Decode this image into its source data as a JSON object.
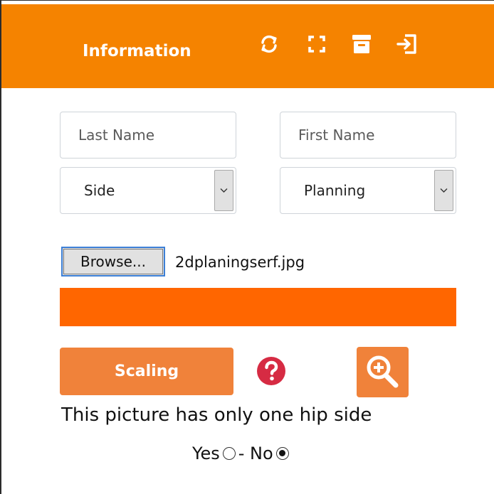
{
  "header": {
    "title": "Information",
    "background": "#f58300",
    "icons": [
      "refresh-icon",
      "fullscreen-icon",
      "archive-icon",
      "exit-icon"
    ]
  },
  "form": {
    "last_name_placeholder": "Last Name",
    "first_name_placeholder": "First Name",
    "side_select": {
      "value": "Side"
    },
    "planning_select": {
      "value": "Planning"
    }
  },
  "file": {
    "browse_label": "Browse...",
    "file_name": "2dplaningserf.jpg"
  },
  "progress": {
    "color": "#ff6600",
    "value": 1.0
  },
  "actions": {
    "scaling_label": "Scaling",
    "accent": "#f0823a",
    "help_icon": "question-icon",
    "zoom_icon": "zoom-in-icon"
  },
  "hip_question": {
    "text": "This picture has only one hip side",
    "yes_label": "Yes",
    "separator": "- No",
    "selected": "No"
  }
}
